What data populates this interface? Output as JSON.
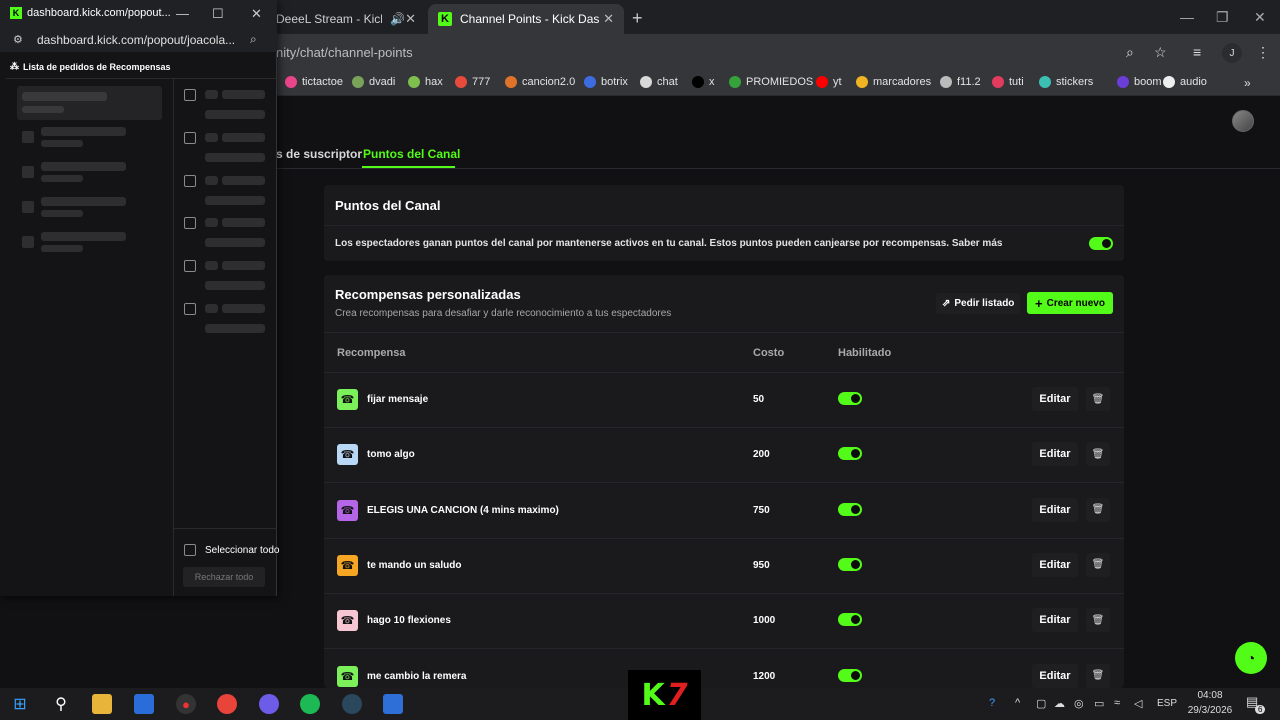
{
  "browser": {
    "tabs": [
      {
        "label": "DeeeL Stream - Kick Da"
      },
      {
        "label": "Channel Points - Kick Dashboar"
      }
    ],
    "url": "nity/chat/channel-points",
    "profile_initial": "J",
    "bookmarks": [
      {
        "label": "tictactoe",
        "color": "#e8458b"
      },
      {
        "label": "dvadi",
        "color": "#7aa35a"
      },
      {
        "label": "hax",
        "color": "#7fbf4e"
      },
      {
        "label": "777",
        "color": "#e84b3c"
      },
      {
        "label": "cancion2.0",
        "color": "#e0732a"
      },
      {
        "label": "botrix",
        "color": "#3d6be0"
      },
      {
        "label": "chat",
        "color": "#d9d9d9"
      },
      {
        "label": "x",
        "color": "#000000"
      },
      {
        "label": "PROMIEDOS",
        "color": "#36a33a"
      },
      {
        "label": "yt",
        "color": "#ff0000"
      },
      {
        "label": "marcadores",
        "color": "#f0b323"
      },
      {
        "label": "f11.2",
        "color": "#bbbbbb"
      },
      {
        "label": "tuti",
        "color": "#e33b5e"
      },
      {
        "label": "stickers",
        "color": "#3cc0b3"
      },
      {
        "label": "boom",
        "color": "#6b3dd9"
      },
      {
        "label": "audio",
        "color": "#eeeeee"
      }
    ]
  },
  "page": {
    "tab_subscriber": "s de suscriptor",
    "tab_points": "Puntos del Canal",
    "section1": {
      "title": "Puntos del Canal",
      "description": "Los espectadores ganan puntos del canal por mantenerse activos en tu canal. Estos puntos pueden canjearse por recompensas. Saber más",
      "enabled": true
    },
    "section2": {
      "title": "Recompensas personalizadas",
      "subtitle": "Crea recompensas para desafiar y darle reconocimiento a tus espectadores",
      "btn_pedir": "Pedir listado",
      "btn_crear": "Crear nuevo",
      "columns": {
        "reward": "Recompensa",
        "cost": "Costo",
        "enabled": "Habilitado"
      },
      "edit_label": "Editar",
      "rows": [
        {
          "name": "fijar mensaje",
          "cost": "50",
          "color": "#7cf05a",
          "enabled": true
        },
        {
          "name": "tomo algo",
          "cost": "200",
          "color": "#b9d8f5",
          "enabled": true
        },
        {
          "name": "ELEGIS UNA CANCION (4 mins maximo)",
          "cost": "750",
          "color": "#b566e8",
          "enabled": true
        },
        {
          "name": "te mando un saludo",
          "cost": "950",
          "color": "#f5a623",
          "enabled": true
        },
        {
          "name": "hago 10 flexiones",
          "cost": "1000",
          "color": "#f7c6d3",
          "enabled": true
        },
        {
          "name": "me cambio la remera",
          "cost": "1200",
          "color": "#7cf05a",
          "enabled": true
        }
      ]
    }
  },
  "popup": {
    "title": "dashboard.kick.com/popout...",
    "url": "dashboard.kick.com/popout/joacola...",
    "header": "Lista de pedidos de Recompensas",
    "select_all": "Seleccionar todo",
    "reject_all": "Rechazar todo"
  },
  "taskbar": {
    "lang": "ESP",
    "time": "04:08",
    "date": "29/3/2026",
    "notif_count": "6"
  },
  "colors": {
    "accent": "#53fc18",
    "background": "#111113",
    "card": "#1a1a1d"
  }
}
